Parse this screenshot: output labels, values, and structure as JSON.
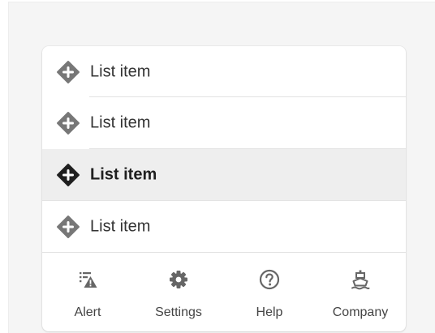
{
  "colors": {
    "page_background": "#f5f5f5",
    "card_background": "#ffffff",
    "selected_background": "#eeeeee",
    "icon_default": "#777777",
    "icon_selected": "#1f1f1f",
    "text": "#333333"
  },
  "list": {
    "selected_index": 2,
    "items": [
      {
        "label": "List item",
        "icon": "diamond-plus-icon"
      },
      {
        "label": "List item",
        "icon": "diamond-plus-icon"
      },
      {
        "label": "List item",
        "icon": "diamond-plus-icon"
      },
      {
        "label": "List item",
        "icon": "diamond-plus-icon"
      }
    ]
  },
  "bottom_nav": {
    "items": [
      {
        "label": "Alert",
        "icon": "alert-list-icon"
      },
      {
        "label": "Settings",
        "icon": "gear-icon"
      },
      {
        "label": "Help",
        "icon": "help-icon"
      },
      {
        "label": "Company",
        "icon": "ship-icon"
      }
    ]
  }
}
